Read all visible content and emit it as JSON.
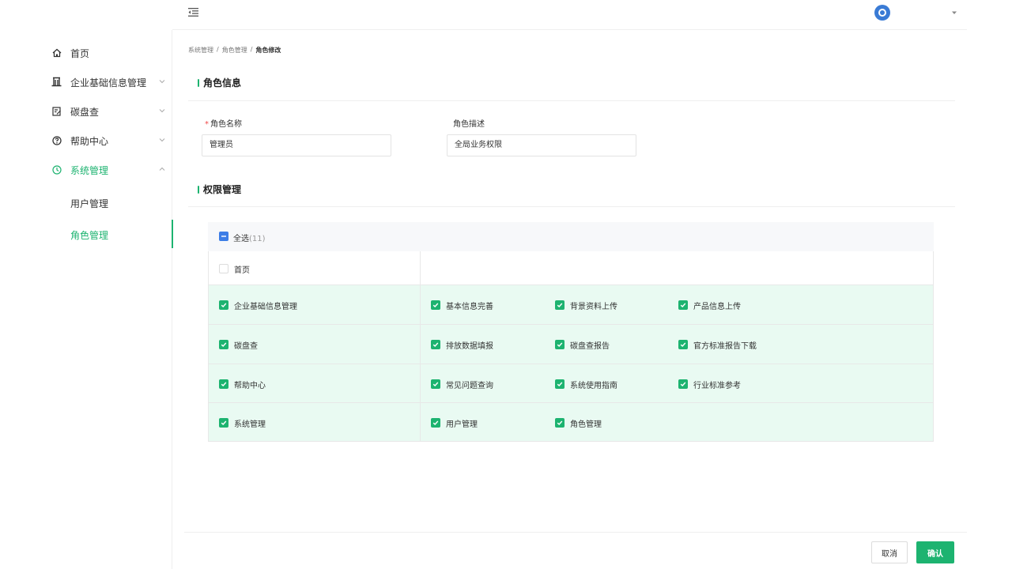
{
  "sidebar": {
    "items": [
      {
        "label": "首页",
        "icon": "home-icon"
      },
      {
        "label": "企业基础信息管理",
        "icon": "building-icon"
      },
      {
        "label": "碳盘查",
        "icon": "edit-doc-icon"
      },
      {
        "label": "帮助中心",
        "icon": "help-circle-icon"
      },
      {
        "label": "系统管理",
        "icon": "settings-clock-icon"
      }
    ],
    "sub_items": [
      {
        "label": "用户管理"
      },
      {
        "label": "角色管理"
      }
    ]
  },
  "breadcrumb": {
    "level1": "系统管理",
    "sep": "/",
    "level2": "角色管理",
    "current": "角色修改"
  },
  "role_info": {
    "title": "角色信息",
    "name_label": "角色名称",
    "name_required_mark": "*",
    "name_value": "管理员",
    "desc_label": "角色描述",
    "desc_value": "全局业务权限"
  },
  "permissions": {
    "title": "权限管理",
    "select_all_label": "全选",
    "select_all_count": "(11)",
    "rows": [
      {
        "label": "首页",
        "checked": false,
        "children": []
      },
      {
        "label": "企业基础信息管理",
        "checked": true,
        "children": [
          {
            "label": "基本信息完善",
            "checked": true
          },
          {
            "label": "背景资料上传",
            "checked": true
          },
          {
            "label": "产品信息上传",
            "checked": true
          }
        ]
      },
      {
        "label": "碳盘查",
        "checked": true,
        "children": [
          {
            "label": "排放数据填报",
            "checked": true
          },
          {
            "label": "碳盘查报告",
            "checked": true
          },
          {
            "label": "官方标准报告下载",
            "checked": true
          }
        ]
      },
      {
        "label": "帮助中心",
        "checked": true,
        "children": [
          {
            "label": "常见问题查询",
            "checked": true
          },
          {
            "label": "系统使用指南",
            "checked": true
          },
          {
            "label": "行业标准参考",
            "checked": true
          }
        ]
      },
      {
        "label": "系统管理",
        "checked": true,
        "children": [
          {
            "label": "用户管理",
            "checked": true
          },
          {
            "label": "角色管理",
            "checked": true
          }
        ]
      }
    ]
  },
  "footer": {
    "cancel_label": "取消",
    "confirm_label": "确认"
  },
  "colors": {
    "accent": "#1db370",
    "checked_row_bg": "#e9faf2",
    "indeterminate": "#3c7de6"
  }
}
